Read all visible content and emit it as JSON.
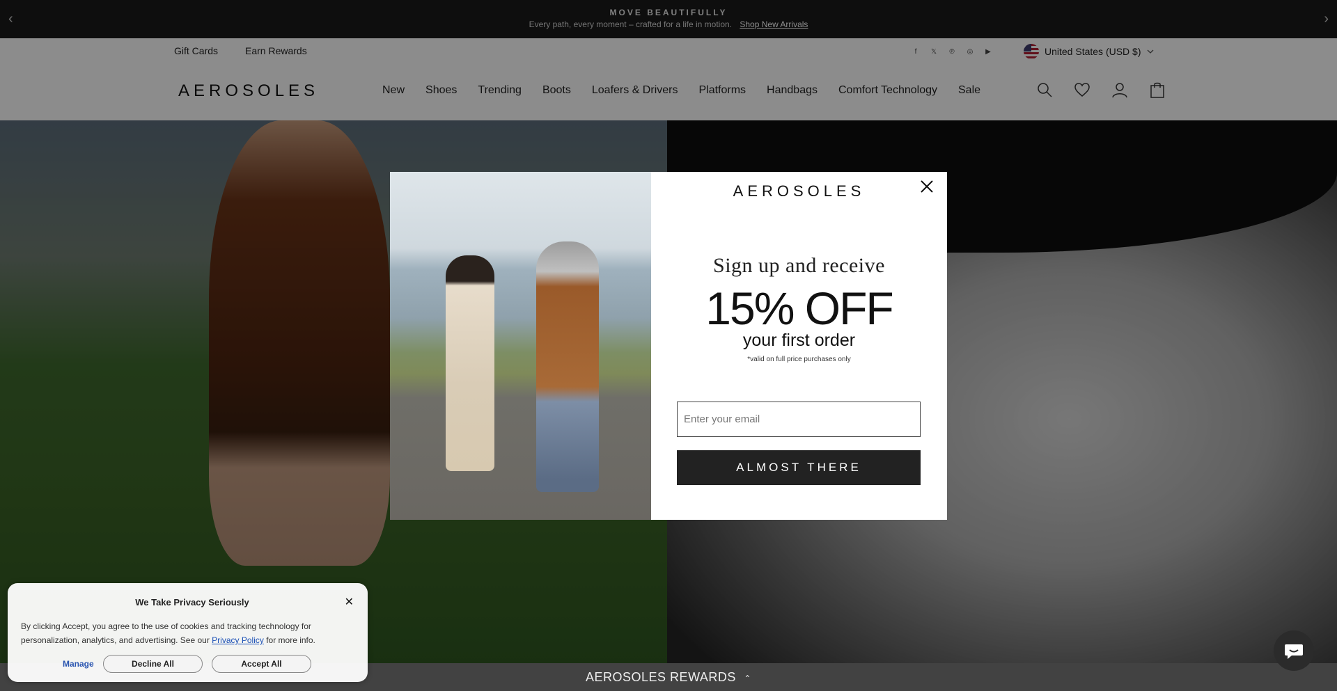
{
  "announcement": {
    "headline": "MOVE BEAUTIFULLY",
    "subtext": "Every path, every moment – crafted for a life in motion.",
    "link": "Shop New Arrivals",
    "prev_icon": "chevron-left-icon",
    "next_icon": "chevron-right-icon"
  },
  "utility": {
    "gift_cards": "Gift Cards",
    "earn_rewards": "Earn Rewards",
    "social": [
      "facebook-icon",
      "x-icon",
      "pinterest-icon",
      "instagram-icon",
      "youtube-icon"
    ],
    "country": "United States (USD $)"
  },
  "nav": {
    "logo": "AEROSOLES",
    "items": [
      "New",
      "Shoes",
      "Trending",
      "Boots",
      "Loafers & Drivers",
      "Platforms",
      "Handbags",
      "Comfort Technology",
      "Sale"
    ],
    "icons": [
      "search-icon",
      "heart-icon",
      "account-icon",
      "bag-icon"
    ]
  },
  "modal": {
    "brand": "AEROSOLES",
    "heading": "Sign up and receive",
    "offer": "15% OFF",
    "subheading": "your first order",
    "note": "*valid on full price purchases only",
    "email_placeholder": "Enter your email",
    "cta": "ALMOST THERE"
  },
  "cookie": {
    "title": "We Take Privacy Seriously",
    "body_before": "By clicking Accept, you agree to the use of cookies and tracking technology for personalization, analytics, and advertising. See our ",
    "policy_link": "Privacy Policy",
    "body_after": " for more info.",
    "manage": "Manage",
    "decline": "Decline All",
    "accept": "Accept All"
  },
  "rewards": {
    "label": "AEROSOLES REWARDS",
    "icon": "chevron-up-icon"
  },
  "colors": {
    "announcement_bg": "#1a1a1a",
    "cta_bg": "#222222",
    "rewards_bg": "#424242",
    "link_blue": "#1a4fb5"
  }
}
